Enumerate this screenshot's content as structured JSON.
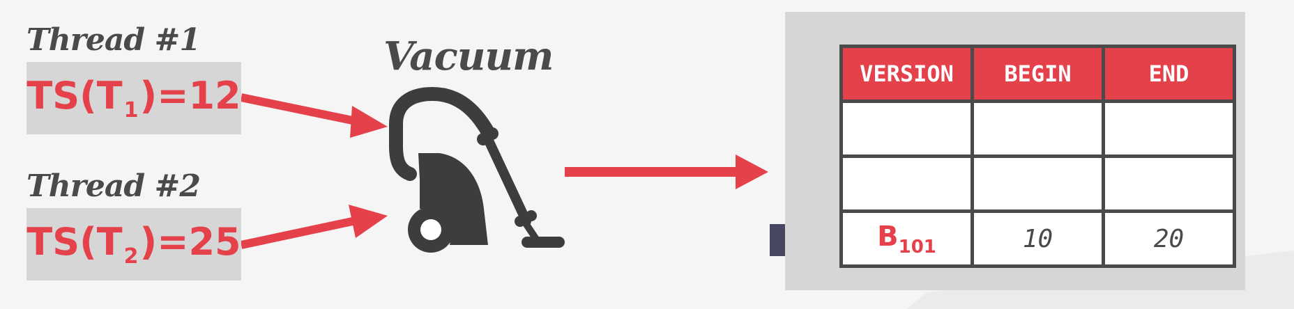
{
  "threads": [
    {
      "label": "Thread #1",
      "ts_prefix": "TS(T",
      "ts_sub": "1",
      "ts_suffix": ")=12"
    },
    {
      "label": "Thread #2",
      "ts_prefix": "TS(T",
      "ts_sub": "2",
      "ts_suffix": ")=25"
    }
  ],
  "vacuum": {
    "label": "Vacuum",
    "icon": "vacuum-cleaner-icon"
  },
  "table": {
    "headers": [
      "VERSION",
      "BEGIN",
      "END"
    ],
    "rows": [
      {
        "version_main": "",
        "version_sub": "",
        "begin": "",
        "end": ""
      },
      {
        "version_main": "",
        "version_sub": "",
        "begin": "",
        "end": ""
      },
      {
        "version_main": "B",
        "version_sub": "101",
        "begin": "10",
        "end": "20"
      }
    ]
  },
  "colors": {
    "accent": "#e5414b",
    "dark": "#4a4a4a",
    "pointer": "#474762",
    "panel": "#d6d6d6"
  }
}
